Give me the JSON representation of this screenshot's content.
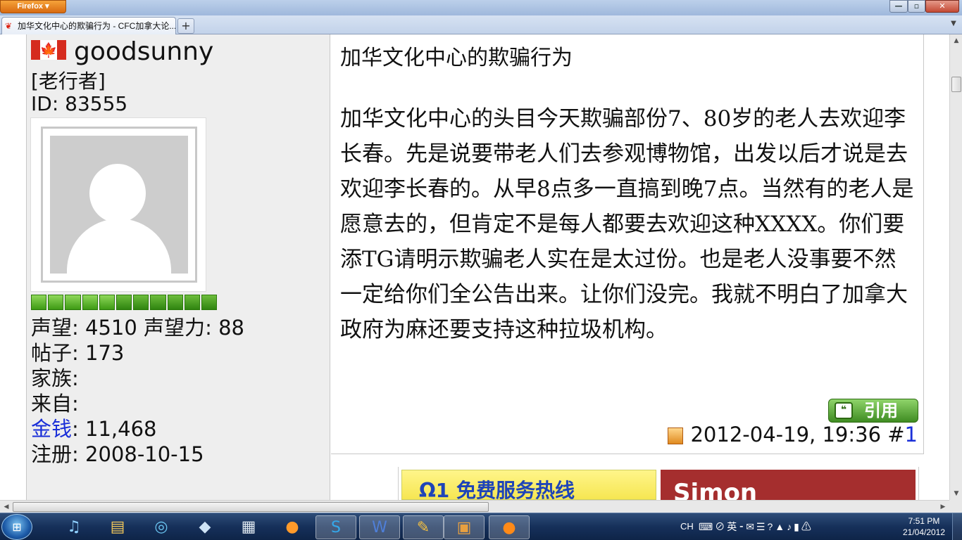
{
  "browser": {
    "menu_label": "Firefox",
    "window_buttons": {
      "minimize": "—",
      "maximize": "▫",
      "close": "✕"
    },
    "tab_title": "加华文化中心的欺骗行为 - CFC加拿大论...",
    "new_tab_label": "+",
    "tab_list_icon": "chevron-down-icon"
  },
  "user": {
    "username": "goodsunny",
    "rank": "[老行者]",
    "id_line": "ID: 83555",
    "flag_leaf": "🍁",
    "level_bar_filled": 11,
    "stats": {
      "reputation_label": "声望",
      "reputation": "4510",
      "rep_power_label": "声望力",
      "rep_power": "88",
      "posts_label": "帖子",
      "posts": "173",
      "clan_label": "家族",
      "clan": "",
      "from_label": "来自",
      "from": "",
      "money_label": "金钱",
      "money": "11,468",
      "register_label": "注册",
      "register": "2008-10-15"
    }
  },
  "post": {
    "title": "加华文化中心的欺骗行为",
    "body": "加华文化中心的头目今天欺骗部份7、80岁的老人去欢迎李长春。先是说要带老人们去参观博物馆，出发以后才说是去欢迎李长春的。从早8点多一直搞到晚7点。当然有的老人是愿意去的，但肯定不是每人都要去欢迎这种XXXX。你们要添TG请明示欺骗老人实在是太过份。也是老人没事要不然一定给你们全公告出来。让你们没完。我就不明白了加拿大政府为麻还要支持这种拉圾机构。",
    "quote_label": "引用",
    "datetime": "2012-04-19, 19:36 #",
    "post_number": "1"
  },
  "ads": {
    "ad1_text": "Ω1 免费服务热线",
    "ad2_text": "Simon"
  },
  "taskbar": {
    "tray_lang": "CH",
    "tray_icons": "⌨⊘英⁃✉☰?▲♪▮⚠",
    "time": "7:51 PM",
    "date": "21/04/2012"
  }
}
